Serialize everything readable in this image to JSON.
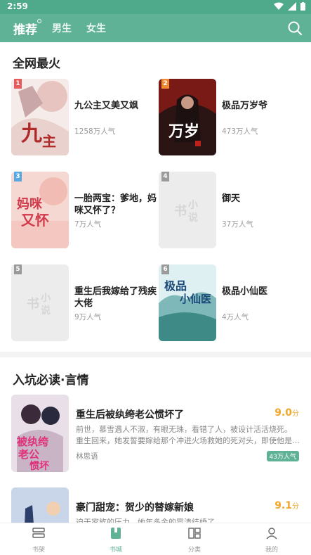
{
  "status": {
    "time": "2:59"
  },
  "topnav": {
    "tabs": [
      {
        "label": "推荐",
        "active": true
      },
      {
        "label": "男生",
        "active": false
      },
      {
        "label": "女生",
        "active": false
      }
    ]
  },
  "hot": {
    "title": "全网最火",
    "books": [
      {
        "rank": "1",
        "title": "九公主又美又飒",
        "popularity": "1258万人气",
        "rank_color": "#e65b5b"
      },
      {
        "rank": "2",
        "title": "极品万岁爷",
        "popularity": "473万人气",
        "rank_color": "#f08a34"
      },
      {
        "rank": "3",
        "title": "一胎两宝：爹地，妈咪又怀了？",
        "popularity": "7万人气",
        "rank_color": "#5aa8e0"
      },
      {
        "rank": "4",
        "title": "御天",
        "popularity": "37万人气",
        "rank_color": "#9a9a9a"
      },
      {
        "rank": "5",
        "title": "重生后我嫁给了残疾大佬",
        "popularity": "9万人气",
        "rank_color": "#9a9a9a"
      },
      {
        "rank": "6",
        "title": "极品小仙医",
        "popularity": "4万人气",
        "rank_color": "#9a9a9a"
      }
    ]
  },
  "recommend": {
    "title": "入坑必读·言情",
    "books": [
      {
        "title": "重生后被纨绔老公惯坏了",
        "score": "9.0",
        "score_unit": "分",
        "desc1": "前世，慕雪遇人不淑，有眼无珠，看错了人，被设计活活烧死。",
        "desc2": "重生回来，她发誓要嫁给那个冲进火场救她的死对头，即使他是个...",
        "author": "林思语",
        "badge": "43万人气"
      },
      {
        "title": "豪门甜宠：贺少的替嫁新娘",
        "score": "9.1",
        "score_unit": "分",
        "desc1": "迫于家族的压力，她年多余的冒渍结婚了"
      }
    ]
  },
  "bottomnav": {
    "items": [
      {
        "label": "书架",
        "icon": "bookshelf-icon"
      },
      {
        "label": "书城",
        "icon": "bookstore-icon",
        "active": true
      },
      {
        "label": "分类",
        "icon": "category-icon"
      },
      {
        "label": "我的",
        "icon": "profile-icon"
      }
    ]
  },
  "colors": {
    "brand": "#5fb295",
    "score": "#f2a62b"
  }
}
